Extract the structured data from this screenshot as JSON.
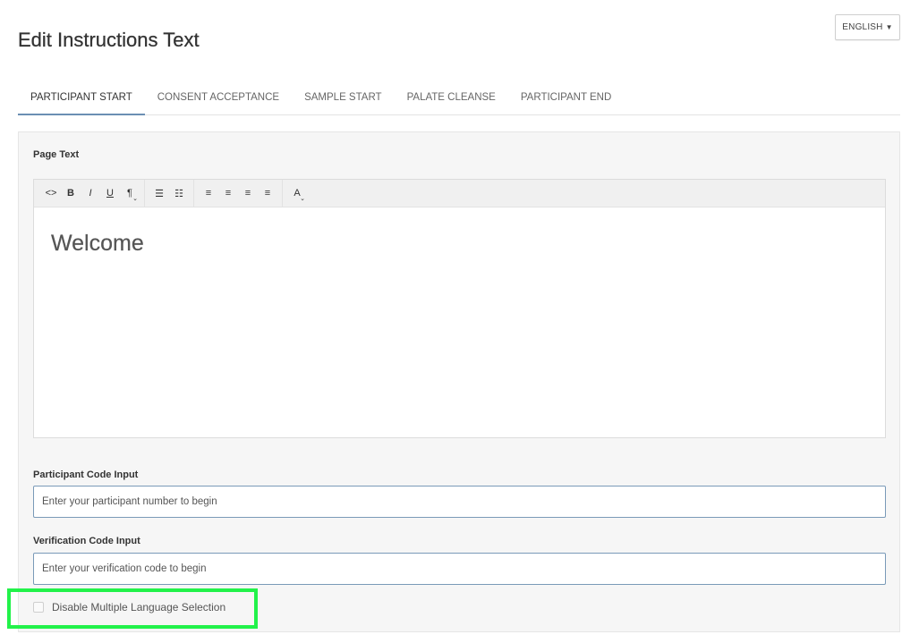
{
  "header": {
    "title": "Edit Instructions Text",
    "language_button": "ENGLISH",
    "language_caret": "▼"
  },
  "tabs": [
    {
      "label": "PARTICIPANT START",
      "active": true
    },
    {
      "label": "CONSENT ACCEPTANCE",
      "active": false
    },
    {
      "label": "SAMPLE START",
      "active": false
    },
    {
      "label": "PALATE CLEANSE",
      "active": false
    },
    {
      "label": "PARTICIPANT END",
      "active": false
    }
  ],
  "page_text": {
    "label": "Page Text",
    "toolbar": {
      "code": "<>",
      "bold": "B",
      "italic": "I",
      "underline": "U",
      "paragraph": "¶",
      "unordered_list": "☰",
      "ordered_list": "☷",
      "align_left": "≡",
      "align_center": "≡",
      "align_right": "≡",
      "justify": "≡",
      "font_color": "A"
    },
    "content": "Welcome"
  },
  "participant_code": {
    "label": "Participant Code Input",
    "value": "Enter your participant number to begin"
  },
  "verification_code": {
    "label": "Verification Code Input",
    "value": "Enter your verification code to begin"
  },
  "disable_language": {
    "label": "Disable Multiple Language Selection",
    "checked": false
  },
  "colors": {
    "highlight": "#22f24a",
    "tab_active_underline": "#6b8fb3",
    "input_border": "#7a9ab8"
  }
}
